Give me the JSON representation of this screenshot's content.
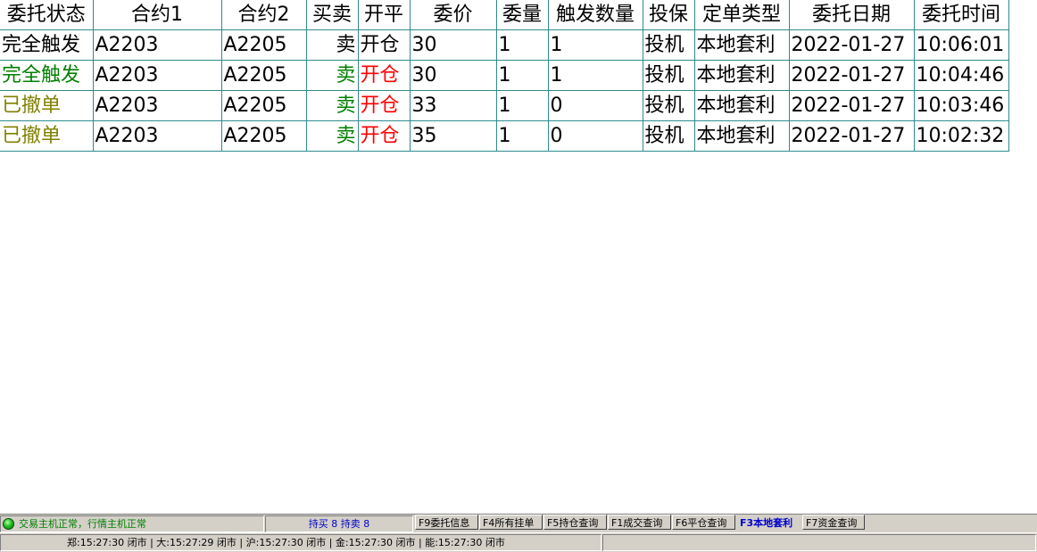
{
  "table": {
    "columns": [
      "委托状态",
      "合约1",
      "合约2",
      "买卖",
      "开平",
      "委价",
      "委量",
      "触发数量",
      "投保",
      "定单类型",
      "委托日期",
      "委托时间"
    ],
    "rows": [
      {
        "status": "完全触发",
        "contract1": "A2203",
        "contract2": "A2205",
        "side": "卖",
        "open_close": "开仓",
        "price": "30",
        "qty": "1",
        "trigger_qty": "1",
        "hedge": "投机",
        "order_type": "本地套利",
        "date": "2022-01-27",
        "time": "10:06:01"
      },
      {
        "status": "完全触发",
        "contract1": "A2203",
        "contract2": "A2205",
        "side": "卖",
        "open_close": "开仓",
        "price": "30",
        "qty": "1",
        "trigger_qty": "1",
        "hedge": "投机",
        "order_type": "本地套利",
        "date": "2022-01-27",
        "time": "10:04:46"
      },
      {
        "status": "已撤单",
        "contract1": "A2203",
        "contract2": "A2205",
        "side": "卖",
        "open_close": "开仓",
        "price": "33",
        "qty": "1",
        "trigger_qty": "0",
        "hedge": "投机",
        "order_type": "本地套利",
        "date": "2022-01-27",
        "time": "10:03:46"
      },
      {
        "status": "已撤单",
        "contract1": "A2203",
        "contract2": "A2205",
        "side": "卖",
        "open_close": "开仓",
        "price": "35",
        "qty": "1",
        "trigger_qty": "0",
        "hedge": "投机",
        "order_type": "本地套利",
        "date": "2022-01-27",
        "time": "10:02:32"
      }
    ]
  },
  "colors": {
    "grid": "#2e8b8b",
    "status_triggered": "#008000",
    "status_cancelled": "#808000",
    "side_sell": "#008000",
    "open_close": "#ff0000",
    "host_ok": "#008000",
    "hold_text": "#0000cc",
    "active_tab": "#0000cc"
  },
  "status_bar": {
    "connection_icon": "green-led-icon",
    "host_status": "交易主机正常，行情主机正常",
    "hold_info": "持买 8  持卖 8",
    "function_keys": [
      {
        "label": "F9委托信息",
        "active": false
      },
      {
        "label": "F4所有挂单",
        "active": false
      },
      {
        "label": "F5持仓查询",
        "active": false
      },
      {
        "label": "F1成交查询",
        "active": false
      },
      {
        "label": "F6平仓查询",
        "active": false
      },
      {
        "label": "F3本地套利",
        "active": true
      },
      {
        "label": "F7资金查询",
        "active": false
      }
    ],
    "clocks": "郑:15:27:30 闭市 | 大:15:27:29 闭市 | 沪:15:27:30 闭市 | 金:15:27:30 闭市 | 能:15:27:30 闭市"
  }
}
